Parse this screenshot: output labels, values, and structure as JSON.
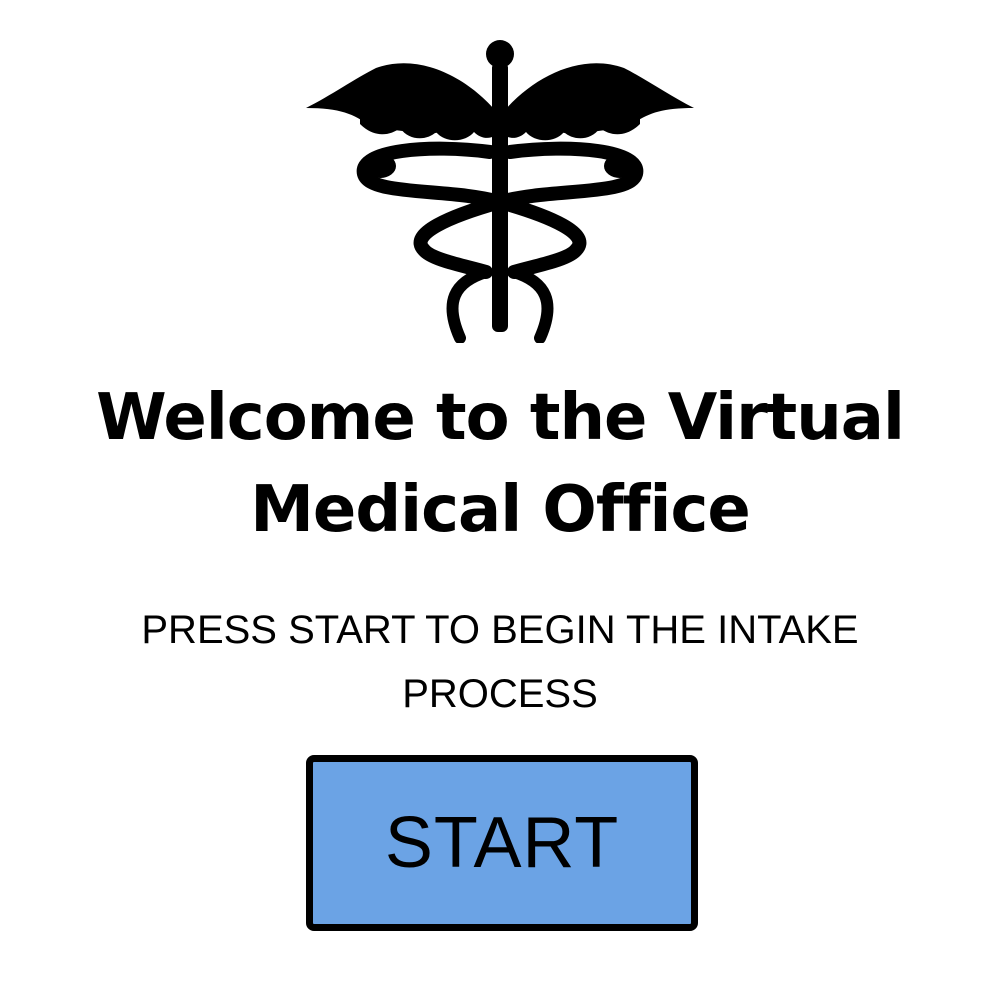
{
  "welcome": {
    "logo_icon": "caduceus-icon",
    "title_line1": "Welcome to the Virtual",
    "title_line2": "Medical Office",
    "instruction_line1": "PRESS START TO BEGIN THE INTAKE",
    "instruction_line2": "PROCESS",
    "start_label": "START"
  },
  "colors": {
    "background": "#ffffff",
    "text": "#000000",
    "button_fill": "#6ba3e5",
    "button_border": "#000000"
  }
}
